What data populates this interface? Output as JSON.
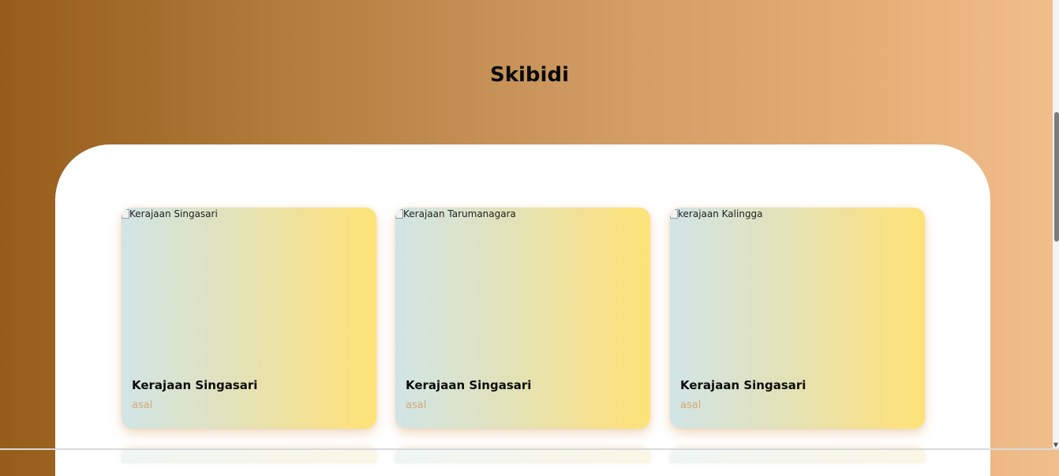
{
  "header": {
    "title": "Skibidi"
  },
  "cards": [
    {
      "alt": "Kerajaan Singasari",
      "title": "Kerajaan Singasari",
      "subtitle": "asal"
    },
    {
      "alt": "Kerajaan Tarumanagara",
      "title": "Kerajaan Singasari",
      "subtitle": "asal"
    },
    {
      "alt": "kerajaan Kalingga",
      "title": "Kerajaan Singasari",
      "subtitle": "asal"
    }
  ],
  "colors": {
    "header_gradient_start": "#965c1a",
    "header_gradient_end": "#f1be8c",
    "card_gradient_start": "#d1e4e6",
    "card_gradient_end": "#fde377",
    "subtitle_color": "#d6a676"
  },
  "icons": {
    "broken_image": "broken-image-icon"
  }
}
